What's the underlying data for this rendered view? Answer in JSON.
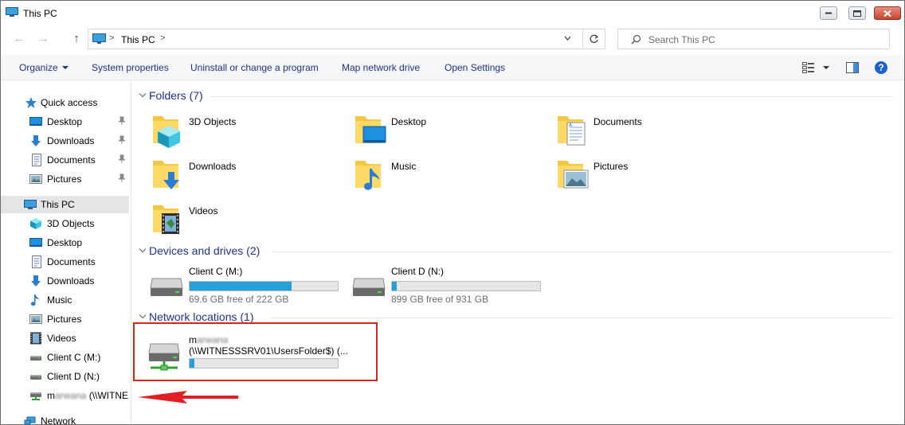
{
  "window": {
    "title": "This PC"
  },
  "address": {
    "crumb": "This PC",
    "sep1": ">",
    "sep2": ">"
  },
  "search": {
    "placeholder": "Search This PC"
  },
  "commands": {
    "organize": "Organize",
    "system_properties": "System properties",
    "uninstall": "Uninstall or change a program",
    "map_drive": "Map network drive",
    "open_settings": "Open Settings"
  },
  "help": {
    "glyph": "?"
  },
  "nav": {
    "quick_access": "Quick access",
    "qa_desktop": "Desktop",
    "qa_downloads": "Downloads",
    "qa_documents": "Documents",
    "qa_pictures": "Pictures",
    "this_pc": "This PC",
    "pc_3d": "3D Objects",
    "pc_desktop": "Desktop",
    "pc_documents": "Documents",
    "pc_downloads": "Downloads",
    "pc_music": "Music",
    "pc_pictures": "Pictures",
    "pc_videos": "Videos",
    "drive_c": "Client C (M:)",
    "drive_d": "Client D (N:)",
    "net_first": "m",
    "net_blur": "arwana",
    "net_rest": " (\\\\WITNE",
    "network": "Network"
  },
  "groups": {
    "folders": "Folders (7)",
    "devices": "Devices and drives (2)",
    "network": "Network locations (1)"
  },
  "folders": {
    "objects3d": "3D Objects",
    "desktop": "Desktop",
    "documents": "Documents",
    "downloads": "Downloads",
    "music": "Music",
    "pictures": "Pictures",
    "videos": "Videos"
  },
  "drives": [
    {
      "name": "Client C (M:)",
      "free_text": "69.6 GB free of 222 GB",
      "used_fraction": 0.69
    },
    {
      "name": "Client D (N:)",
      "free_text": "899 GB free of 931 GB",
      "used_fraction": 0.03
    }
  ],
  "network_location": {
    "name_first": "m",
    "name_blur": "arwana",
    "path": "(\\\\WITNESSSRV01\\UsersFolder$) (...",
    "used_fraction": 0.03
  },
  "colors": {
    "link_blue": "#1e3287",
    "bar_fill": "#26a0da",
    "highlight_red": "#d9261c"
  }
}
